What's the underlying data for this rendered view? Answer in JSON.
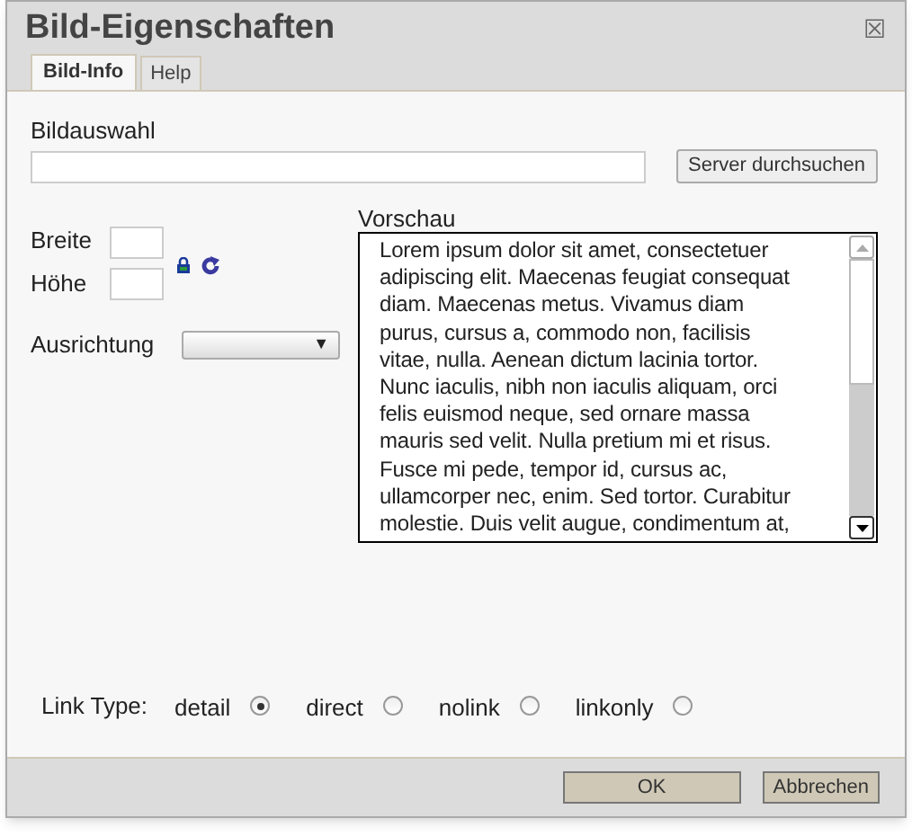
{
  "window": {
    "title": "Bild-Eigenschaften",
    "close": "☒"
  },
  "tabs": [
    {
      "label": "Bild-Info",
      "selected": true
    },
    {
      "label": "Help",
      "selected": false
    }
  ],
  "image_select": {
    "label": "Bildauswahl",
    "button": "Server durchsuchen"
  },
  "size": {
    "width_label": "Breite",
    "height_label": "Höhe",
    "locked": true
  },
  "alignment": {
    "label": "Ausrichtung",
    "arrow": "▼"
  },
  "preview": {
    "label": "Vorschau",
    "lines": [
      "Lorem ipsum dolor sit amet, consectetuer",
      "adipiscing elit. Maecenas feugiat consequat",
      "diam. Maecenas metus. Vivamus diam",
      "purus, cursus a, commodo non, facilisis",
      "vitae, nulla. Aenean dictum lacinia tortor.",
      "Nunc iaculis, nibh non iaculis aliquam, orci",
      "felis euismod neque, sed ornare massa",
      "mauris sed velit. Nulla pretium mi et risus.",
      "Fusce mi pede, tempor id, cursus ac,",
      "ullamcorper nec, enim. Sed tortor. Curabitur",
      "molestie. Duis velit augue, condimentum at,"
    ]
  },
  "link_type": {
    "label": "Link Type:",
    "options": [
      {
        "label": "detail",
        "selected": true
      },
      {
        "label": "direct",
        "selected": false
      },
      {
        "label": "nolink",
        "selected": false
      },
      {
        "label": "linkonly",
        "selected": false
      }
    ]
  },
  "buttons": [
    "OK",
    "Abbrechen"
  ]
}
